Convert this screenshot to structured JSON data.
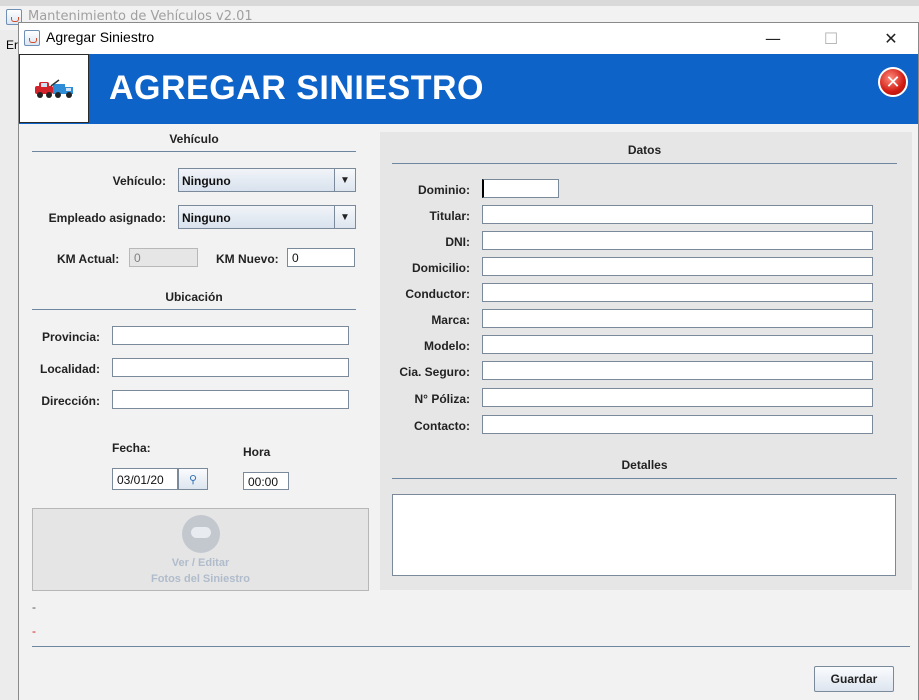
{
  "parent_window": {
    "title": "Mantenimiento de Vehículos v2.01",
    "side_menu_label": "Er"
  },
  "dialog": {
    "title": "Agregar Siniestro",
    "minimize": "—",
    "maximize": "☐",
    "close": "✕"
  },
  "banner": {
    "title": "AGREGAR SINIESTRO",
    "logo_icon": "tow-truck-icon",
    "close_icon": "red-close-icon",
    "close_glyph": "✕"
  },
  "vehiculo": {
    "heading": "Vehículo",
    "vehiculo_label": "Vehículo:",
    "vehiculo_value": "Ninguno",
    "empleado_label": "Empleado asignado:",
    "empleado_value": "Ninguno",
    "km_actual_label": "KM Actual:",
    "km_actual_value": "0",
    "km_nuevo_label": "KM Nuevo:",
    "km_nuevo_value": "0"
  },
  "ubicacion": {
    "heading": "Ubicación",
    "provincia_label": "Provincia:",
    "provincia_value": "",
    "localidad_label": "Localidad:",
    "localidad_value": "",
    "direccion_label": "Dirección:",
    "direccion_value": ""
  },
  "fecha": {
    "label": "Fecha:",
    "value": "03/01/20",
    "picker_glyph": "⚲"
  },
  "hora": {
    "label": "Hora",
    "value": "00:00"
  },
  "photos": {
    "line1": "Ver / Editar",
    "line2": "Fotos del Siniestro"
  },
  "status_lines": [
    "-",
    "-"
  ],
  "datos": {
    "heading": "Datos",
    "fields": [
      {
        "label": "Dominio:",
        "value": ""
      },
      {
        "label": "Titular:",
        "value": ""
      },
      {
        "label": "DNI:",
        "value": ""
      },
      {
        "label": "Domicilio:",
        "value": ""
      },
      {
        "label": "Conductor:",
        "value": ""
      },
      {
        "label": "Marca:",
        "value": ""
      },
      {
        "label": "Modelo:",
        "value": ""
      },
      {
        "label": "Cia. Seguro:",
        "value": ""
      },
      {
        "label": "N° Póliza:",
        "value": ""
      },
      {
        "label": "Contacto:",
        "value": ""
      }
    ]
  },
  "detalles": {
    "heading": "Detalles",
    "value": ""
  },
  "actions": {
    "guardar_label": "Guardar"
  },
  "colors": {
    "banner": "#0d63c8",
    "panel": "#f2f2f2",
    "accent_rule": "#6e86a0"
  }
}
